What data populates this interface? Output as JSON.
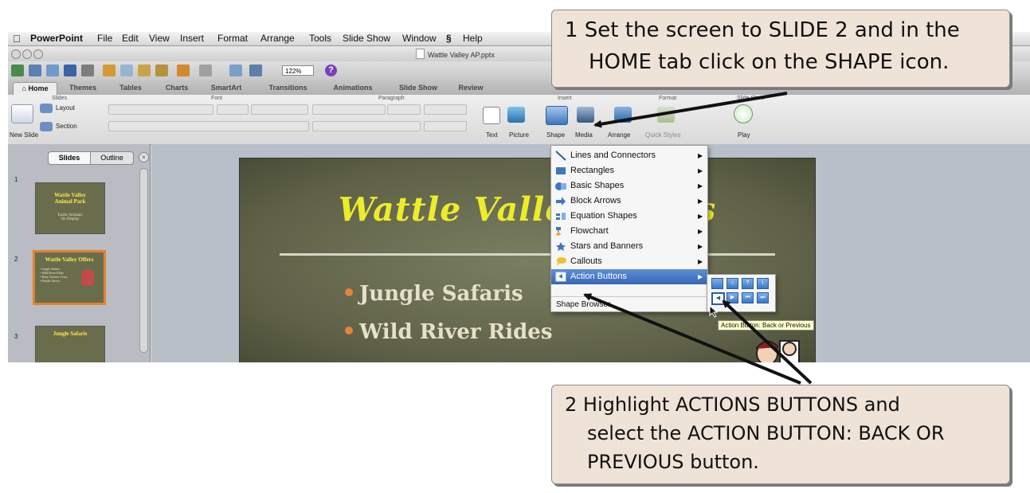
{
  "menubar": {
    "app": "PowerPoint",
    "items": [
      "File",
      "Edit",
      "View",
      "Insert",
      "Format",
      "Arrange",
      "Tools",
      "Slide Show",
      "Window",
      "Help"
    ]
  },
  "window": {
    "title": "Wattle Valley AP.pptx",
    "zoom": "122%"
  },
  "ribbon": {
    "tabs": [
      "Home",
      "Themes",
      "Tables",
      "Charts",
      "SmartArt",
      "Transitions",
      "Animations",
      "Slide Show",
      "Review"
    ],
    "groups": {
      "slides": "Slides",
      "font": "Font",
      "paragraph": "Paragraph",
      "insert": "Insert",
      "format": "Format",
      "slideshow": "Slide Show"
    },
    "new_slide": "New Slide",
    "layout": "Layout",
    "section": "Section",
    "insert_buttons": [
      "Text",
      "Picture",
      "Shape",
      "Media"
    ],
    "format_buttons": [
      "Arrange",
      "Quick Styles"
    ],
    "play": "Play"
  },
  "left_pane": {
    "tab_slides": "Slides",
    "tab_outline": "Outline",
    "thumbnails": [
      {
        "num": "1",
        "title": "Wattle Valley\nAnimal Park",
        "sub": "Exotic Animals\nOn Display"
      },
      {
        "num": "2",
        "title": "Wattle Valley Offers",
        "sub": "• Jungle Safaris\n• Wild River Rides\n• Baby Nursery Tours\n• Reptile Shows"
      },
      {
        "num": "3",
        "title": "Jungle Safaris",
        "sub": ""
      }
    ]
  },
  "slide": {
    "title": "Wattle Valley Offers",
    "bullets": [
      "Jungle Safaris",
      "Wild River Rides"
    ]
  },
  "shape_menu": {
    "items": [
      {
        "label": "Lines and Connectors",
        "icon": "lines-icon"
      },
      {
        "label": "Rectangles",
        "icon": "rectangles-icon"
      },
      {
        "label": "Basic Shapes",
        "icon": "basic-shapes-icon"
      },
      {
        "label": "Block Arrows",
        "icon": "block-arrows-icon"
      },
      {
        "label": "Equation Shapes",
        "icon": "equation-shapes-icon"
      },
      {
        "label": "Flowchart",
        "icon": "flowchart-icon"
      },
      {
        "label": "Stars and Banners",
        "icon": "stars-banners-icon"
      },
      {
        "label": "Callouts",
        "icon": "callouts-icon"
      },
      {
        "label": "Action Buttons",
        "icon": "action-buttons-icon"
      }
    ],
    "footer": "Shape Browser...",
    "highlighted": "Action Buttons"
  },
  "tooltip": "Action Button: Back or Previous",
  "callouts": {
    "step1": [
      "1 Set the screen to SLIDE 2 and in the",
      "HOME tab click on the SHAPE icon."
    ],
    "step2": [
      "2 Highlight ACTIONS BUTTONS and",
      "select the ACTION BUTTON: BACK OR",
      "PREVIOUS button."
    ]
  },
  "colors": {
    "highlight": "#3f72c0",
    "callout_fill": "#efe3d8",
    "slide_title": "#ecec2a",
    "bullet_dot": "#e6843c",
    "selected_thumb": "#e2822c"
  }
}
